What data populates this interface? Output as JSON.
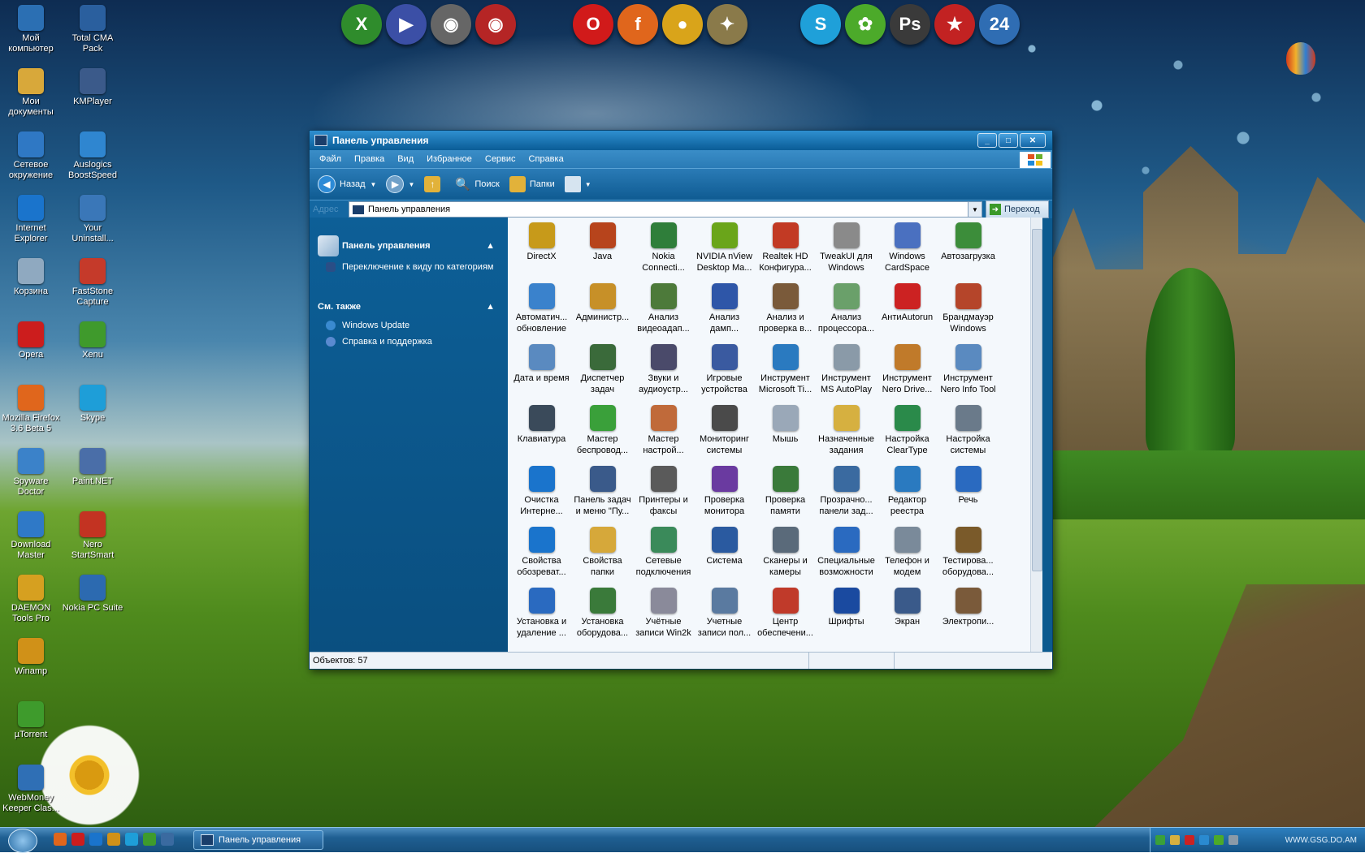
{
  "desktop": {
    "icons_col1": [
      {
        "label": "Мой компьютер",
        "icon": "computer-icon",
        "color": "#2b6fb3"
      },
      {
        "label": "Мои документы",
        "icon": "folder-documents-icon",
        "color": "#d8a83a"
      },
      {
        "label": "Сетевое окружение",
        "icon": "network-icon",
        "color": "#2f78c4"
      },
      {
        "label": "Internet Explorer",
        "icon": "internet-explorer-icon",
        "color": "#1a74cc"
      },
      {
        "label": "Корзина",
        "icon": "recycle-bin-icon",
        "color": "#8fa9c0"
      },
      {
        "label": "Opera",
        "icon": "opera-icon",
        "color": "#cc1d1d"
      },
      {
        "label": "Mozilla Firefox 3.6 Beta 5",
        "icon": "firefox-icon",
        "color": "#e0661c"
      },
      {
        "label": "Spyware Doctor",
        "icon": "spyware-doctor-icon",
        "color": "#3b82c9"
      },
      {
        "label": "Download Master",
        "icon": "download-master-icon",
        "color": "#2f79c7"
      },
      {
        "label": "DAEMON Tools Pro",
        "icon": "daemon-tools-icon",
        "color": "#d6a020"
      },
      {
        "label": "Winamp",
        "icon": "winamp-icon",
        "color": "#d09118"
      },
      {
        "label": "µTorrent",
        "icon": "utorrent-icon",
        "color": "#3e9b2c"
      },
      {
        "label": "WebMoney Keeper Clas...",
        "icon": "webmoney-icon",
        "color": "#2f6fb5"
      }
    ],
    "icons_col2": [
      {
        "label": "Total CMA Pack",
        "icon": "total-cma-icon",
        "color": "#2a5f9e"
      },
      {
        "label": "KMPlayer",
        "icon": "kmplayer-icon",
        "color": "#3b5a8a"
      },
      {
        "label": "Auslogics BoostSpeed",
        "icon": "boostspeed-icon",
        "color": "#2f86d0"
      },
      {
        "label": "Your Uninstall...",
        "icon": "uninstaller-icon",
        "color": "#3a77b8"
      },
      {
        "label": "FastStone Capture",
        "icon": "faststone-icon",
        "color": "#c53a2a"
      },
      {
        "label": "Xenu",
        "icon": "xenu-icon",
        "color": "#3f9a2c"
      },
      {
        "label": "Skype",
        "icon": "skype-icon",
        "color": "#1e9ed8"
      },
      {
        "label": "Paint.NET",
        "icon": "paintnet-icon",
        "color": "#4a6ea8"
      },
      {
        "label": "Nero StartSmart",
        "icon": "nero-icon",
        "color": "#c33322"
      },
      {
        "label": "Nokia PC Suite",
        "icon": "nokia-pc-suite-icon",
        "color": "#2c6ab0"
      }
    ]
  },
  "dock": [
    {
      "icon": "excel-icon",
      "glyph": "X",
      "color": "#2f8c2c"
    },
    {
      "icon": "media-player-icon",
      "glyph": "▶",
      "color": "#3b4fa6"
    },
    {
      "icon": "alien-icon",
      "glyph": "◉",
      "color": "#666666"
    },
    {
      "icon": "alien-red-icon",
      "glyph": "◉",
      "color": "#b52525"
    },
    {
      "icon": "opera-dock-icon",
      "glyph": "O",
      "color": "#d11a1a"
    },
    {
      "icon": "firefox-dock-icon",
      "glyph": "f",
      "color": "#e0661c"
    },
    {
      "icon": "chrome-icon",
      "glyph": "●",
      "color": "#d9a41a"
    },
    {
      "icon": "tools-icon",
      "glyph": "✦",
      "color": "#8a7a4a"
    },
    {
      "icon": "skype-dock-icon",
      "glyph": "S",
      "color": "#1fa0d9"
    },
    {
      "icon": "icq-icon",
      "glyph": "✿",
      "color": "#4caa2a"
    },
    {
      "icon": "photoshop-icon",
      "glyph": "Ps",
      "color": "#3a3a3a"
    },
    {
      "icon": "star-icon",
      "glyph": "★",
      "color": "#c22222"
    },
    {
      "icon": "calendar-icon",
      "glyph": "24",
      "color": "#2f6db3"
    }
  ],
  "window": {
    "title": "Панель управления",
    "menu": [
      "Файл",
      "Правка",
      "Вид",
      "Избранное",
      "Сервис",
      "Справка"
    ],
    "toolbar": {
      "back": "Назад",
      "search": "Поиск",
      "folders": "Папки"
    },
    "address": {
      "label": "Адрес",
      "value": "Панель управления",
      "go": "Переход"
    },
    "taskpane": {
      "section1_title": "Панель управления",
      "switch_view": "Переключение к виду по категориям",
      "section2_title": "См. также",
      "links": [
        "Windows Update",
        "Справка и поддержка"
      ]
    },
    "items": [
      {
        "label": "DirectX",
        "icon": "directx-icon",
        "color": "#c79a1a"
      },
      {
        "label": "Java",
        "icon": "java-icon",
        "color": "#b7441c"
      },
      {
        "label": "Nokia Connecti...",
        "icon": "nokia-connectivity-icon",
        "color": "#2f7e3a"
      },
      {
        "label": "NVIDIA nView Desktop Ma...",
        "icon": "nvidia-icon",
        "color": "#6aa51a"
      },
      {
        "label": "Realtek HD Конфигура...",
        "icon": "realtek-icon",
        "color": "#c23a24"
      },
      {
        "label": "TweakUI для Windows",
        "icon": "tweakui-icon",
        "color": "#8a8a8a"
      },
      {
        "label": "Windows CardSpace",
        "icon": "cardspace-icon",
        "color": "#4a70c0"
      },
      {
        "label": "Автозагрузка",
        "icon": "autostart-icon",
        "color": "#3c8d3a"
      },
      {
        "label": "Автоматич... обновление",
        "icon": "automatic-updates-icon",
        "color": "#3a82cc"
      },
      {
        "label": "Администр...",
        "icon": "administrative-tools-icon",
        "color": "#c79028"
      },
      {
        "label": "Анализ видеоадап...",
        "icon": "video-adapter-icon",
        "color": "#4d7a3a"
      },
      {
        "label": "Анализ дамп...",
        "icon": "dump-analysis-icon",
        "color": "#2e56a8"
      },
      {
        "label": "Анализ и проверка в...",
        "icon": "disk-check-icon",
        "color": "#7a5a3a"
      },
      {
        "label": "Анализ процессора...",
        "icon": "processor-icon",
        "color": "#6aa06a"
      },
      {
        "label": "АнтиAutorun",
        "icon": "antiautorun-icon",
        "color": "#cc2222"
      },
      {
        "label": "Брандмауэр Windows",
        "icon": "firewall-icon",
        "color": "#b5452a"
      },
      {
        "label": "Дата и время",
        "icon": "date-time-icon",
        "color": "#5a8ac0"
      },
      {
        "label": "Диспетчер задач",
        "icon": "task-manager-icon",
        "color": "#3a6a3a"
      },
      {
        "label": "Звуки и аудиоустр...",
        "icon": "sounds-icon",
        "color": "#4a4a6a"
      },
      {
        "label": "Игровые устройства",
        "icon": "game-controllers-icon",
        "color": "#3a5aa0"
      },
      {
        "label": "Инструмент Microsoft Ti...",
        "icon": "microsoft-tool-icon",
        "color": "#2a7ac0"
      },
      {
        "label": "Инструмент MS AutoPlay",
        "icon": "autoplay-icon",
        "color": "#8a9aa8"
      },
      {
        "label": "Инструмент Nero Drive...",
        "icon": "nero-drive-icon",
        "color": "#c07a2a"
      },
      {
        "label": "Инструмент Nero Info Tool",
        "icon": "nero-info-icon",
        "color": "#5a8ac0"
      },
      {
        "label": "Клавиатура",
        "icon": "keyboard-icon",
        "color": "#3a4a5a"
      },
      {
        "label": "Мастер беспровод...",
        "icon": "wireless-wizard-icon",
        "color": "#3aa03a"
      },
      {
        "label": "Мастер настрой...",
        "icon": "network-setup-icon",
        "color": "#c06a3a"
      },
      {
        "label": "Мониторинг системы",
        "icon": "system-monitor-icon",
        "color": "#4a4a4a"
      },
      {
        "label": "Мышь",
        "icon": "mouse-icon",
        "color": "#9aa8b8"
      },
      {
        "label": "Назначенные задания",
        "icon": "scheduled-tasks-icon",
        "color": "#d6b040"
      },
      {
        "label": "Настройка ClearType",
        "icon": "cleartype-icon",
        "color": "#2a8a4a"
      },
      {
        "label": "Настройка системы",
        "icon": "system-settings-icon",
        "color": "#6a7a8a"
      },
      {
        "label": "Очистка Интерне...",
        "icon": "internet-options-icon",
        "color": "#1a74cc"
      },
      {
        "label": "Панель задач и меню \"Пу...",
        "icon": "taskbar-menu-icon",
        "color": "#3a5a8a"
      },
      {
        "label": "Принтеры и факсы",
        "icon": "printers-icon",
        "color": "#5a5a5a"
      },
      {
        "label": "Проверка монитора",
        "icon": "monitor-check-icon",
        "color": "#6a3aa0"
      },
      {
        "label": "Проверка памяти",
        "icon": "memory-check-icon",
        "color": "#3a7a3a"
      },
      {
        "label": "Прозрачно... панели зад...",
        "icon": "transparency-icon",
        "color": "#3a6aa0"
      },
      {
        "label": "Редактор реестра",
        "icon": "registry-editor-icon",
        "color": "#2a7ac0"
      },
      {
        "label": "Речь",
        "icon": "speech-icon",
        "color": "#2a6ac0"
      },
      {
        "label": "Свойства обозреват...",
        "icon": "browser-properties-icon",
        "color": "#1a74cc"
      },
      {
        "label": "Свойства папки",
        "icon": "folder-options-icon",
        "color": "#d6a83a"
      },
      {
        "label": "Сетевые подключения",
        "icon": "network-connections-icon",
        "color": "#3a8a5a"
      },
      {
        "label": "Система",
        "icon": "system-icon",
        "color": "#2a5aa0"
      },
      {
        "label": "Сканеры и камеры",
        "icon": "scanners-icon",
        "color": "#5a6a7a"
      },
      {
        "label": "Специальные возможности",
        "icon": "accessibility-icon",
        "color": "#2a6ac0"
      },
      {
        "label": "Телефон и модем",
        "icon": "phone-modem-icon",
        "color": "#7a8a9a"
      },
      {
        "label": "Тестирова... оборудова...",
        "icon": "hardware-test-icon",
        "color": "#7a5a2a"
      },
      {
        "label": "Установка и удаление ...",
        "icon": "add-remove-programs-icon",
        "color": "#2a6ac0"
      },
      {
        "label": "Установка оборудова...",
        "icon": "add-hardware-icon",
        "color": "#3a7a3a"
      },
      {
        "label": "Учётные записи Win2k",
        "icon": "accounts-win2k-icon",
        "color": "#8a8a9a"
      },
      {
        "label": "Учетные записи пол...",
        "icon": "user-accounts-icon",
        "color": "#5a7aa0"
      },
      {
        "label": "Центр обеспечени...",
        "icon": "security-center-icon",
        "color": "#c03a2a"
      },
      {
        "label": "Шрифты",
        "icon": "fonts-icon",
        "color": "#1a4aa0"
      },
      {
        "label": "Экран",
        "icon": "display-icon",
        "color": "#3a5a8a"
      },
      {
        "label": "Электропи...",
        "icon": "power-options-icon",
        "color": "#7a5a3a"
      }
    ],
    "status": "Объектов: 57"
  },
  "taskbar": {
    "task_label": "Панель управления",
    "quicklaunch": [
      {
        "icon": "firefox-ql-icon",
        "color": "#e0661c"
      },
      {
        "icon": "opera-ql-icon",
        "color": "#cc1d1d"
      },
      {
        "icon": "ie-ql-icon",
        "color": "#1a74cc"
      },
      {
        "icon": "winamp-ql-icon",
        "color": "#d09118"
      },
      {
        "icon": "skype-ql-icon",
        "color": "#1e9ed8"
      },
      {
        "icon": "utorrent-ql-icon",
        "color": "#3e9b2c"
      },
      {
        "icon": "show-desktop-icon",
        "color": "#3a6aa0"
      }
    ],
    "tray": [
      {
        "icon": "tray-network-icon",
        "color": "#3aa03a"
      },
      {
        "icon": "tray-volume-icon",
        "color": "#d6b040"
      },
      {
        "icon": "tray-antivirus-icon",
        "color": "#cc2222"
      },
      {
        "icon": "tray-update-icon",
        "color": "#2a8ad0"
      },
      {
        "icon": "tray-icq-icon",
        "color": "#4caa2a"
      },
      {
        "icon": "tray-safely-remove-icon",
        "color": "#8a9aa8"
      }
    ],
    "watermark": "WWW.GSG.DO.AM"
  }
}
